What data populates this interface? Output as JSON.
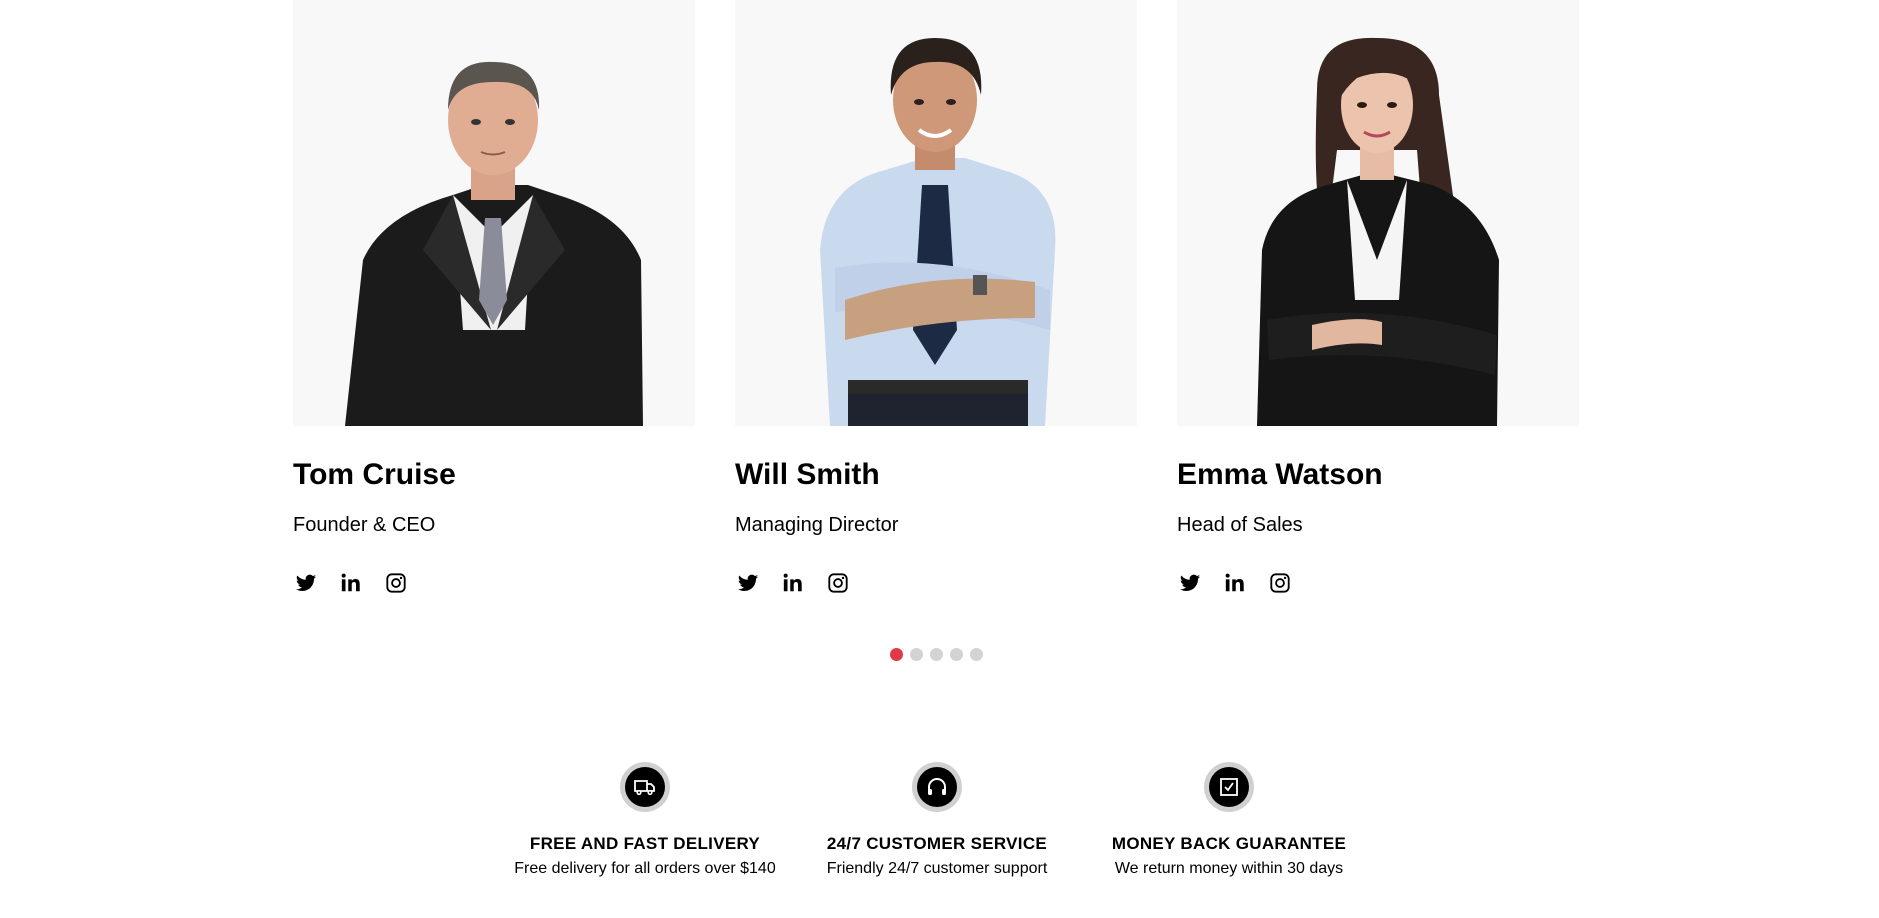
{
  "team": [
    {
      "name": "Tom Cruise",
      "role": "Founder & CEO",
      "photo_alt": "Tom Cruise portrait"
    },
    {
      "name": "Will Smith",
      "role": "Managing Director",
      "photo_alt": "Will Smith portrait"
    },
    {
      "name": "Emma Watson",
      "role": "Head of Sales",
      "photo_alt": "Emma Watson portrait"
    }
  ],
  "social_icons": [
    "twitter-icon",
    "linkedin-icon",
    "instagram-icon"
  ],
  "carousel": {
    "pages": 5,
    "active_page": 1,
    "active_color": "#e03a48",
    "inactive_color": "#d3d3d3"
  },
  "features": [
    {
      "icon": "truck-icon",
      "title": "FREE AND FAST DELIVERY",
      "description": "Free delivery for all orders over $140"
    },
    {
      "icon": "headphones-icon",
      "title": "24/7 CUSTOMER SERVICE",
      "description": "Friendly 24/7 customer support"
    },
    {
      "icon": "check-square-icon",
      "title": "MONEY BACK GUARANTEE",
      "description": "We return money within 30 days"
    }
  ]
}
